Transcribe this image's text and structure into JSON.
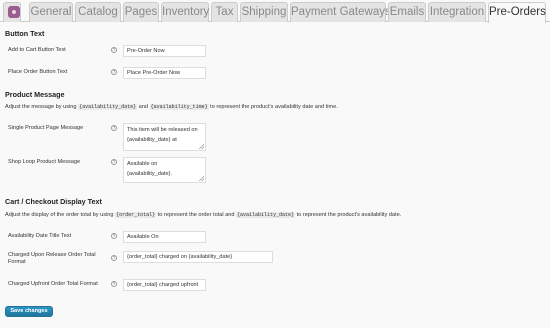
{
  "tabs": [
    {
      "label": ""
    },
    {
      "label": "General"
    },
    {
      "label": "Catalog"
    },
    {
      "label": "Pages"
    },
    {
      "label": "Inventory"
    },
    {
      "label": "Tax"
    },
    {
      "label": "Shipping"
    },
    {
      "label": "Payment Gateways"
    },
    {
      "label": "Emails"
    },
    {
      "label": "Integration"
    },
    {
      "label": "Pre-Orders"
    }
  ],
  "button_text": {
    "heading": "Button Text",
    "add_to_cart": {
      "label": "Add to Cart Button Text",
      "value": "Pre-Order Now"
    },
    "place_order": {
      "label": "Place Order Button Text",
      "value": "Place Pre-Order Now"
    }
  },
  "product_message": {
    "heading": "Product Message",
    "desc_prefix": "Adjust the message by using",
    "code1": "{availability_date}",
    "desc_and": "and",
    "code2": "{availability_time}",
    "desc_suffix": "to represent the product's availability date and time.",
    "single": {
      "label": "Single Product Page Message",
      "value": "This item will be released on {availability_date} at"
    },
    "loop": {
      "label": "Shop Loop Product Message",
      "value": "Available on {availability_date}."
    }
  },
  "cart_checkout": {
    "heading": "Cart / Checkout Display Text",
    "desc_prefix": "Adjust the display of the order total by using",
    "code1": "{order_total}",
    "desc_mid": "to represent the order total and",
    "code2": "{availability_date}",
    "desc_suffix": "to represent the product's availability date.",
    "availability_title": {
      "label": "Availability Date Title Text",
      "value": "Available On"
    },
    "charged_release": {
      "label": "Charged Upon Release Order Total Format",
      "value": "{order_total} charged on {availability_date}"
    },
    "charged_upfront": {
      "label": "Charged Upfront Order Total Format",
      "value": "{order_total} charged upfront"
    }
  },
  "help_glyph": "?",
  "save_button": "Save changes"
}
